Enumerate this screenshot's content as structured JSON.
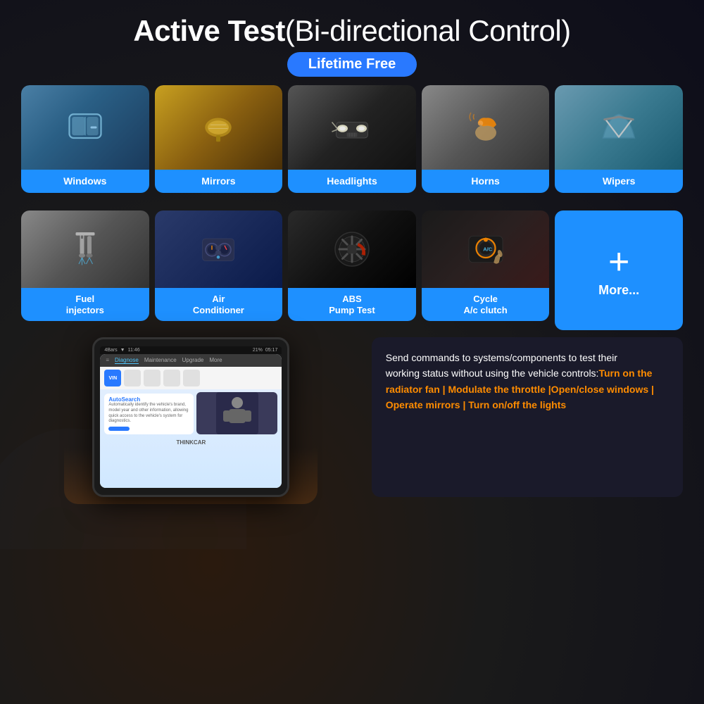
{
  "title": {
    "bold_part": "Active Test",
    "normal_part": "(Bi-directional Control)",
    "badge": "Lifetime Free"
  },
  "top_features": [
    {
      "id": "windows",
      "label": "Windows",
      "bg_class": "img-windows"
    },
    {
      "id": "mirrors",
      "label": "Mirrors",
      "bg_class": "img-mirrors"
    },
    {
      "id": "headlights",
      "label": "Headlights",
      "bg_class": "img-headlights"
    },
    {
      "id": "horns",
      "label": "Horns",
      "bg_class": "img-horns"
    },
    {
      "id": "wipers",
      "label": "Wipers",
      "bg_class": "img-wipers"
    }
  ],
  "bottom_features": [
    {
      "id": "fuel",
      "label": "Fuel\ninjectors",
      "bg_class": "img-fuel"
    },
    {
      "id": "ac",
      "label": "Air\nConditioner",
      "bg_class": "img-ac"
    },
    {
      "id": "abs",
      "label": "ABS\nPump Test",
      "bg_class": "img-abs"
    },
    {
      "id": "cycle",
      "label": "Cycle\nA/c clutch",
      "bg_class": "img-cycle"
    }
  ],
  "more_tile": {
    "plus": "+",
    "label": "More..."
  },
  "tablet": {
    "nav_items": [
      "Diagnose",
      "Maintenance",
      "Upgrade",
      "More"
    ],
    "active_nav": "Diagnose",
    "autosearch_title": "AutoSearch",
    "autosearch_text": "Automatically identify the vehicle's brand, model year and other information, allowing quick access to the vehicle's system for diagnostics.",
    "brand": "THINKCAR"
  },
  "info_box": {
    "normal_1": "Send commands to systems/components to test their",
    "normal_2": "working status without using the vehicle controls:",
    "highlight": "Turn on the radiator fan | Modulate the throttle |Open/close windows | Operate mirrors | Turn on/off the lights"
  }
}
